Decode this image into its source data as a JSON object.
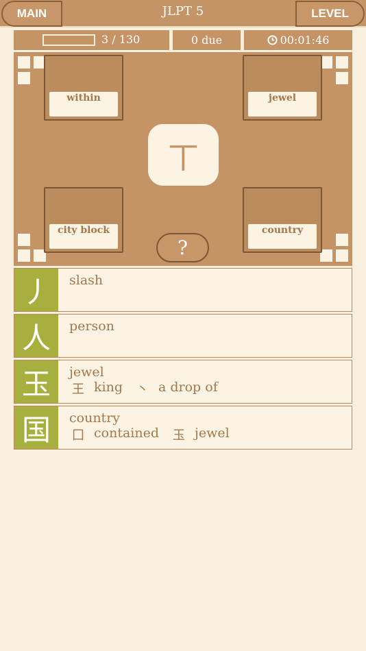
{
  "header": {
    "main_label": "MAIN",
    "title": "JLPT 5",
    "level_label": "LEVEL"
  },
  "status": {
    "progress_fraction": 0.0,
    "progress_text": "3 / 130",
    "due_text": "0 due",
    "timer_text": "00:01:46",
    "timer_icon": "clock-icon"
  },
  "board": {
    "center_kanji": "丅",
    "hint_label": "?",
    "cards": [
      {
        "label": "within"
      },
      {
        "label": "jewel"
      },
      {
        "label": "city block"
      },
      {
        "label": "country"
      }
    ]
  },
  "list": [
    {
      "kanji": "丿",
      "meaning": "slash",
      "parts": []
    },
    {
      "kanji": "人",
      "meaning": "person",
      "parts": []
    },
    {
      "kanji": "玉",
      "meaning": "jewel",
      "parts": [
        {
          "kanji": "王",
          "meaning": "king"
        },
        {
          "kanji": "丶",
          "meaning": "a drop of"
        }
      ]
    },
    {
      "kanji": "国",
      "meaning": "country",
      "parts": [
        {
          "kanji": "囗",
          "meaning": "contained"
        },
        {
          "kanji": "玉",
          "meaning": "jewel"
        }
      ]
    }
  ],
  "colors": {
    "background": "#f8f0de",
    "brown": "#c49366",
    "kanji_green": "#a7b03e",
    "text": "#a4774a"
  }
}
